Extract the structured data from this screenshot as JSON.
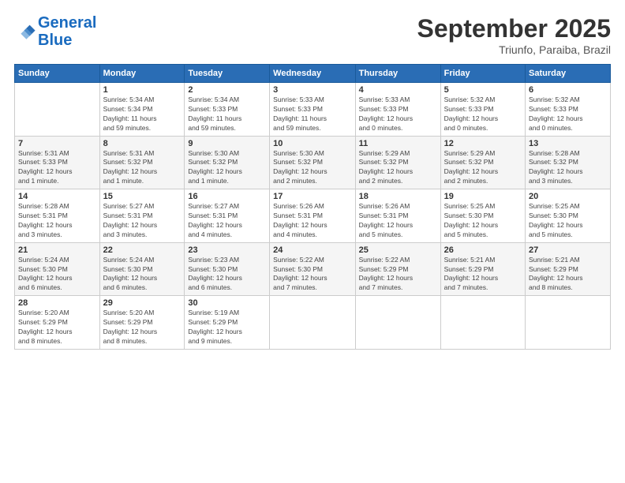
{
  "logo": {
    "line1": "General",
    "line2": "Blue"
  },
  "header": {
    "month": "September 2025",
    "location": "Triunfo, Paraiba, Brazil"
  },
  "weekdays": [
    "Sunday",
    "Monday",
    "Tuesday",
    "Wednesday",
    "Thursday",
    "Friday",
    "Saturday"
  ],
  "weeks": [
    [
      {
        "day": "",
        "info": ""
      },
      {
        "day": "1",
        "info": "Sunrise: 5:34 AM\nSunset: 5:34 PM\nDaylight: 11 hours\nand 59 minutes."
      },
      {
        "day": "2",
        "info": "Sunrise: 5:34 AM\nSunset: 5:33 PM\nDaylight: 11 hours\nand 59 minutes."
      },
      {
        "day": "3",
        "info": "Sunrise: 5:33 AM\nSunset: 5:33 PM\nDaylight: 11 hours\nand 59 minutes."
      },
      {
        "day": "4",
        "info": "Sunrise: 5:33 AM\nSunset: 5:33 PM\nDaylight: 12 hours\nand 0 minutes."
      },
      {
        "day": "5",
        "info": "Sunrise: 5:32 AM\nSunset: 5:33 PM\nDaylight: 12 hours\nand 0 minutes."
      },
      {
        "day": "6",
        "info": "Sunrise: 5:32 AM\nSunset: 5:33 PM\nDaylight: 12 hours\nand 0 minutes."
      }
    ],
    [
      {
        "day": "7",
        "info": "Sunrise: 5:31 AM\nSunset: 5:33 PM\nDaylight: 12 hours\nand 1 minute."
      },
      {
        "day": "8",
        "info": "Sunrise: 5:31 AM\nSunset: 5:32 PM\nDaylight: 12 hours\nand 1 minute."
      },
      {
        "day": "9",
        "info": "Sunrise: 5:30 AM\nSunset: 5:32 PM\nDaylight: 12 hours\nand 1 minute."
      },
      {
        "day": "10",
        "info": "Sunrise: 5:30 AM\nSunset: 5:32 PM\nDaylight: 12 hours\nand 2 minutes."
      },
      {
        "day": "11",
        "info": "Sunrise: 5:29 AM\nSunset: 5:32 PM\nDaylight: 12 hours\nand 2 minutes."
      },
      {
        "day": "12",
        "info": "Sunrise: 5:29 AM\nSunset: 5:32 PM\nDaylight: 12 hours\nand 2 minutes."
      },
      {
        "day": "13",
        "info": "Sunrise: 5:28 AM\nSunset: 5:32 PM\nDaylight: 12 hours\nand 3 minutes."
      }
    ],
    [
      {
        "day": "14",
        "info": "Sunrise: 5:28 AM\nSunset: 5:31 PM\nDaylight: 12 hours\nand 3 minutes."
      },
      {
        "day": "15",
        "info": "Sunrise: 5:27 AM\nSunset: 5:31 PM\nDaylight: 12 hours\nand 3 minutes."
      },
      {
        "day": "16",
        "info": "Sunrise: 5:27 AM\nSunset: 5:31 PM\nDaylight: 12 hours\nand 4 minutes."
      },
      {
        "day": "17",
        "info": "Sunrise: 5:26 AM\nSunset: 5:31 PM\nDaylight: 12 hours\nand 4 minutes."
      },
      {
        "day": "18",
        "info": "Sunrise: 5:26 AM\nSunset: 5:31 PM\nDaylight: 12 hours\nand 5 minutes."
      },
      {
        "day": "19",
        "info": "Sunrise: 5:25 AM\nSunset: 5:30 PM\nDaylight: 12 hours\nand 5 minutes."
      },
      {
        "day": "20",
        "info": "Sunrise: 5:25 AM\nSunset: 5:30 PM\nDaylight: 12 hours\nand 5 minutes."
      }
    ],
    [
      {
        "day": "21",
        "info": "Sunrise: 5:24 AM\nSunset: 5:30 PM\nDaylight: 12 hours\nand 6 minutes."
      },
      {
        "day": "22",
        "info": "Sunrise: 5:24 AM\nSunset: 5:30 PM\nDaylight: 12 hours\nand 6 minutes."
      },
      {
        "day": "23",
        "info": "Sunrise: 5:23 AM\nSunset: 5:30 PM\nDaylight: 12 hours\nand 6 minutes."
      },
      {
        "day": "24",
        "info": "Sunrise: 5:22 AM\nSunset: 5:30 PM\nDaylight: 12 hours\nand 7 minutes."
      },
      {
        "day": "25",
        "info": "Sunrise: 5:22 AM\nSunset: 5:29 PM\nDaylight: 12 hours\nand 7 minutes."
      },
      {
        "day": "26",
        "info": "Sunrise: 5:21 AM\nSunset: 5:29 PM\nDaylight: 12 hours\nand 7 minutes."
      },
      {
        "day": "27",
        "info": "Sunrise: 5:21 AM\nSunset: 5:29 PM\nDaylight: 12 hours\nand 8 minutes."
      }
    ],
    [
      {
        "day": "28",
        "info": "Sunrise: 5:20 AM\nSunset: 5:29 PM\nDaylight: 12 hours\nand 8 minutes."
      },
      {
        "day": "29",
        "info": "Sunrise: 5:20 AM\nSunset: 5:29 PM\nDaylight: 12 hours\nand 8 minutes."
      },
      {
        "day": "30",
        "info": "Sunrise: 5:19 AM\nSunset: 5:29 PM\nDaylight: 12 hours\nand 9 minutes."
      },
      {
        "day": "",
        "info": ""
      },
      {
        "day": "",
        "info": ""
      },
      {
        "day": "",
        "info": ""
      },
      {
        "day": "",
        "info": ""
      }
    ]
  ]
}
